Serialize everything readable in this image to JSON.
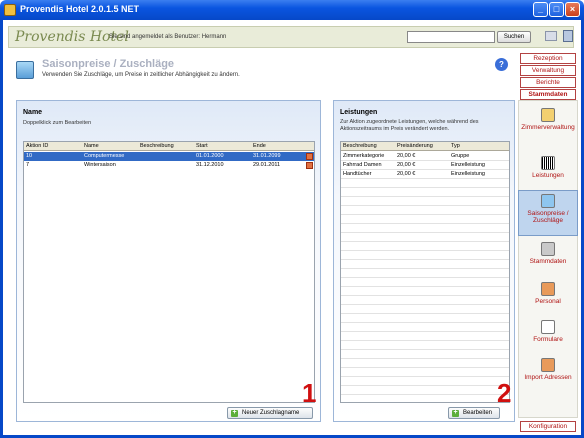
{
  "window": {
    "title": "Provendis Hotel 2.0.1.5 NET"
  },
  "header": {
    "logo": "Provendis Hotel",
    "login_info": "Sie sind angemeldet als Benutzer: Hermann",
    "search_value": "",
    "search_button": "Suchen"
  },
  "page": {
    "title": "Saisonpreise / Zuschläge",
    "subtitle": "Verwenden Sie Zuschläge, um Preise in zeitlicher Abhängigkeit zu ändern."
  },
  "left_panel": {
    "title": "Name",
    "hint": "Doppelklick zum Bearbeiten",
    "columns": [
      "Aktion ID",
      "Name",
      "Beschreibung",
      "Start",
      "Ende"
    ],
    "rows": [
      {
        "id": "10",
        "name": "Computermesse",
        "desc": "",
        "start": "01.01.2000",
        "end": "31.01.2099",
        "selected": true
      },
      {
        "id": "7",
        "name": "Wintersaison",
        "desc": "",
        "start": "31.12.2010",
        "end": "29.01.2011",
        "selected": false
      }
    ],
    "new_button": "Neuer Zuschlagname",
    "marker": "1"
  },
  "right_panel": {
    "title": "Leistungen",
    "hint": "Zur Aktion zugeordnete Leistungen, welche während des Aktionszeitraums im Preis verändert werden.",
    "columns": [
      "Beschreibung",
      "Preisänderung",
      "Typ"
    ],
    "rows": [
      {
        "desc": "Zimmerkategorie",
        "price": "20,00 €",
        "type": "Gruppe"
      },
      {
        "desc": "Fahrrad Damen",
        "price": "20,00 €",
        "type": "Einzelleistung"
      },
      {
        "desc": "Handtücher",
        "price": "20,00 €",
        "type": "Einzelleistung"
      }
    ],
    "edit_button": "Bearbeiten",
    "marker": "2"
  },
  "nav": {
    "top": [
      "Rezeption",
      "Verwaltung",
      "Berichte",
      "Stammdaten"
    ],
    "items": [
      {
        "label": "Zimmerverwaltung",
        "icon": "clipboard-icon"
      },
      {
        "label": "Leistungen",
        "icon": "barcode-icon"
      },
      {
        "label": "Saisonpreise / Zuschläge",
        "icon": "calculator-icon",
        "active": true
      },
      {
        "label": "Stammdaten",
        "icon": "pencil-icon"
      },
      {
        "label": "Personal",
        "icon": "people-icon"
      },
      {
        "label": "Formulare",
        "icon": "document-icon"
      },
      {
        "label": "Import Adressen",
        "icon": "import-people-icon"
      }
    ],
    "bottom": "Konfiguration"
  },
  "colors": {
    "accent": "#b01414",
    "selection": "#316ac5",
    "titlebar": "#0a55e0"
  }
}
